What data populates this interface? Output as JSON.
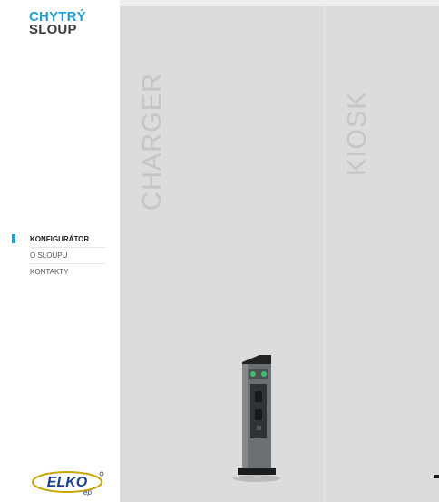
{
  "brand": {
    "line1": "CHYTRÝ",
    "line2": "SLOUP"
  },
  "nav": {
    "items": [
      {
        "label": "KONFIGURÁTOR",
        "active": true
      },
      {
        "label": "O SLOUPU",
        "active": false
      },
      {
        "label": "KONTAKTY",
        "active": false
      }
    ]
  },
  "panels": {
    "charger": {
      "title": "CHARGER"
    },
    "kiosk": {
      "title": "KIOSK"
    }
  },
  "footer_logo": {
    "text": "ELKO",
    "subtext": "ep"
  },
  "colors": {
    "accent": "#1f9fd8",
    "dark_text": "#3d3d3d",
    "panel_bg": "#dcdcdc",
    "title_gray": "#c5c5c5"
  }
}
